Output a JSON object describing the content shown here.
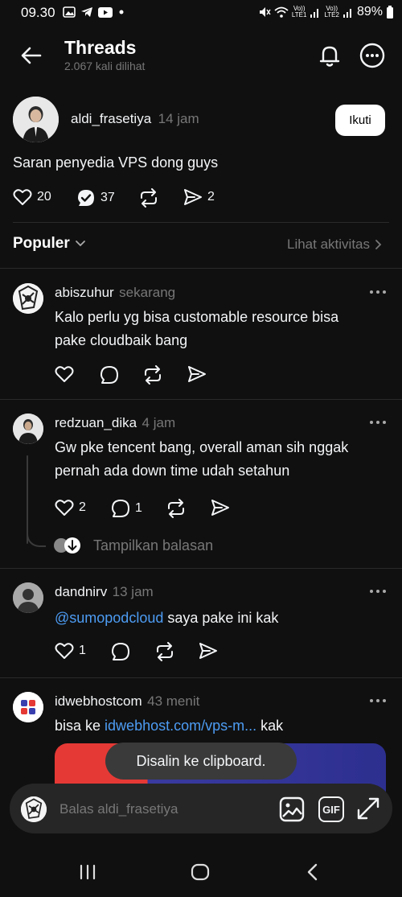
{
  "status_bar": {
    "time": "09.30",
    "battery": "89%",
    "lte1": "LTE1",
    "lte2": "LTE2",
    "volte": "Vo))"
  },
  "header": {
    "title": "Threads",
    "subtitle": "2.067 kali dilihat"
  },
  "post": {
    "username": "aldi_frasetiya",
    "time": "14 jam",
    "follow_label": "Ikuti",
    "text": "Saran penyedia VPS dong guys",
    "likes": "20",
    "replies": "37",
    "shares": "2"
  },
  "sort": {
    "label": "Populer",
    "activity": "Lihat aktivitas"
  },
  "replies": [
    {
      "username": "abiszuhur",
      "time": "sekarang",
      "line1": "Kalo perlu yg bisa customable resource bisa",
      "line2": "pake cloudbaik bang"
    },
    {
      "username": "redzuan_dika",
      "time": "4 jam",
      "line1": "Gw pke tencent bang, overall aman sih nggak",
      "line2": "pernah ada down time udah setahun",
      "likes": "2",
      "replies": "1",
      "show_replies": "Tampilkan balasan"
    },
    {
      "username": "dandnirv",
      "time": "13 jam",
      "mention": "@sumopodcloud",
      "text_after": " saya pake ini kak",
      "likes": "1"
    },
    {
      "username": "idwebhostcom",
      "time": "43 menit",
      "text_before": "bisa ke ",
      "link": "idwebhost.com/vps-m...",
      "text_after": " kak"
    }
  ],
  "toast": "Disalin ke clipboard.",
  "composer": {
    "placeholder": "Balas aldi_frasetiya",
    "gif_label": "GIF"
  },
  "colors": {
    "background": "#101010",
    "text": "#f3f5f7",
    "muted": "#777777",
    "link": "#4d9cf3"
  }
}
